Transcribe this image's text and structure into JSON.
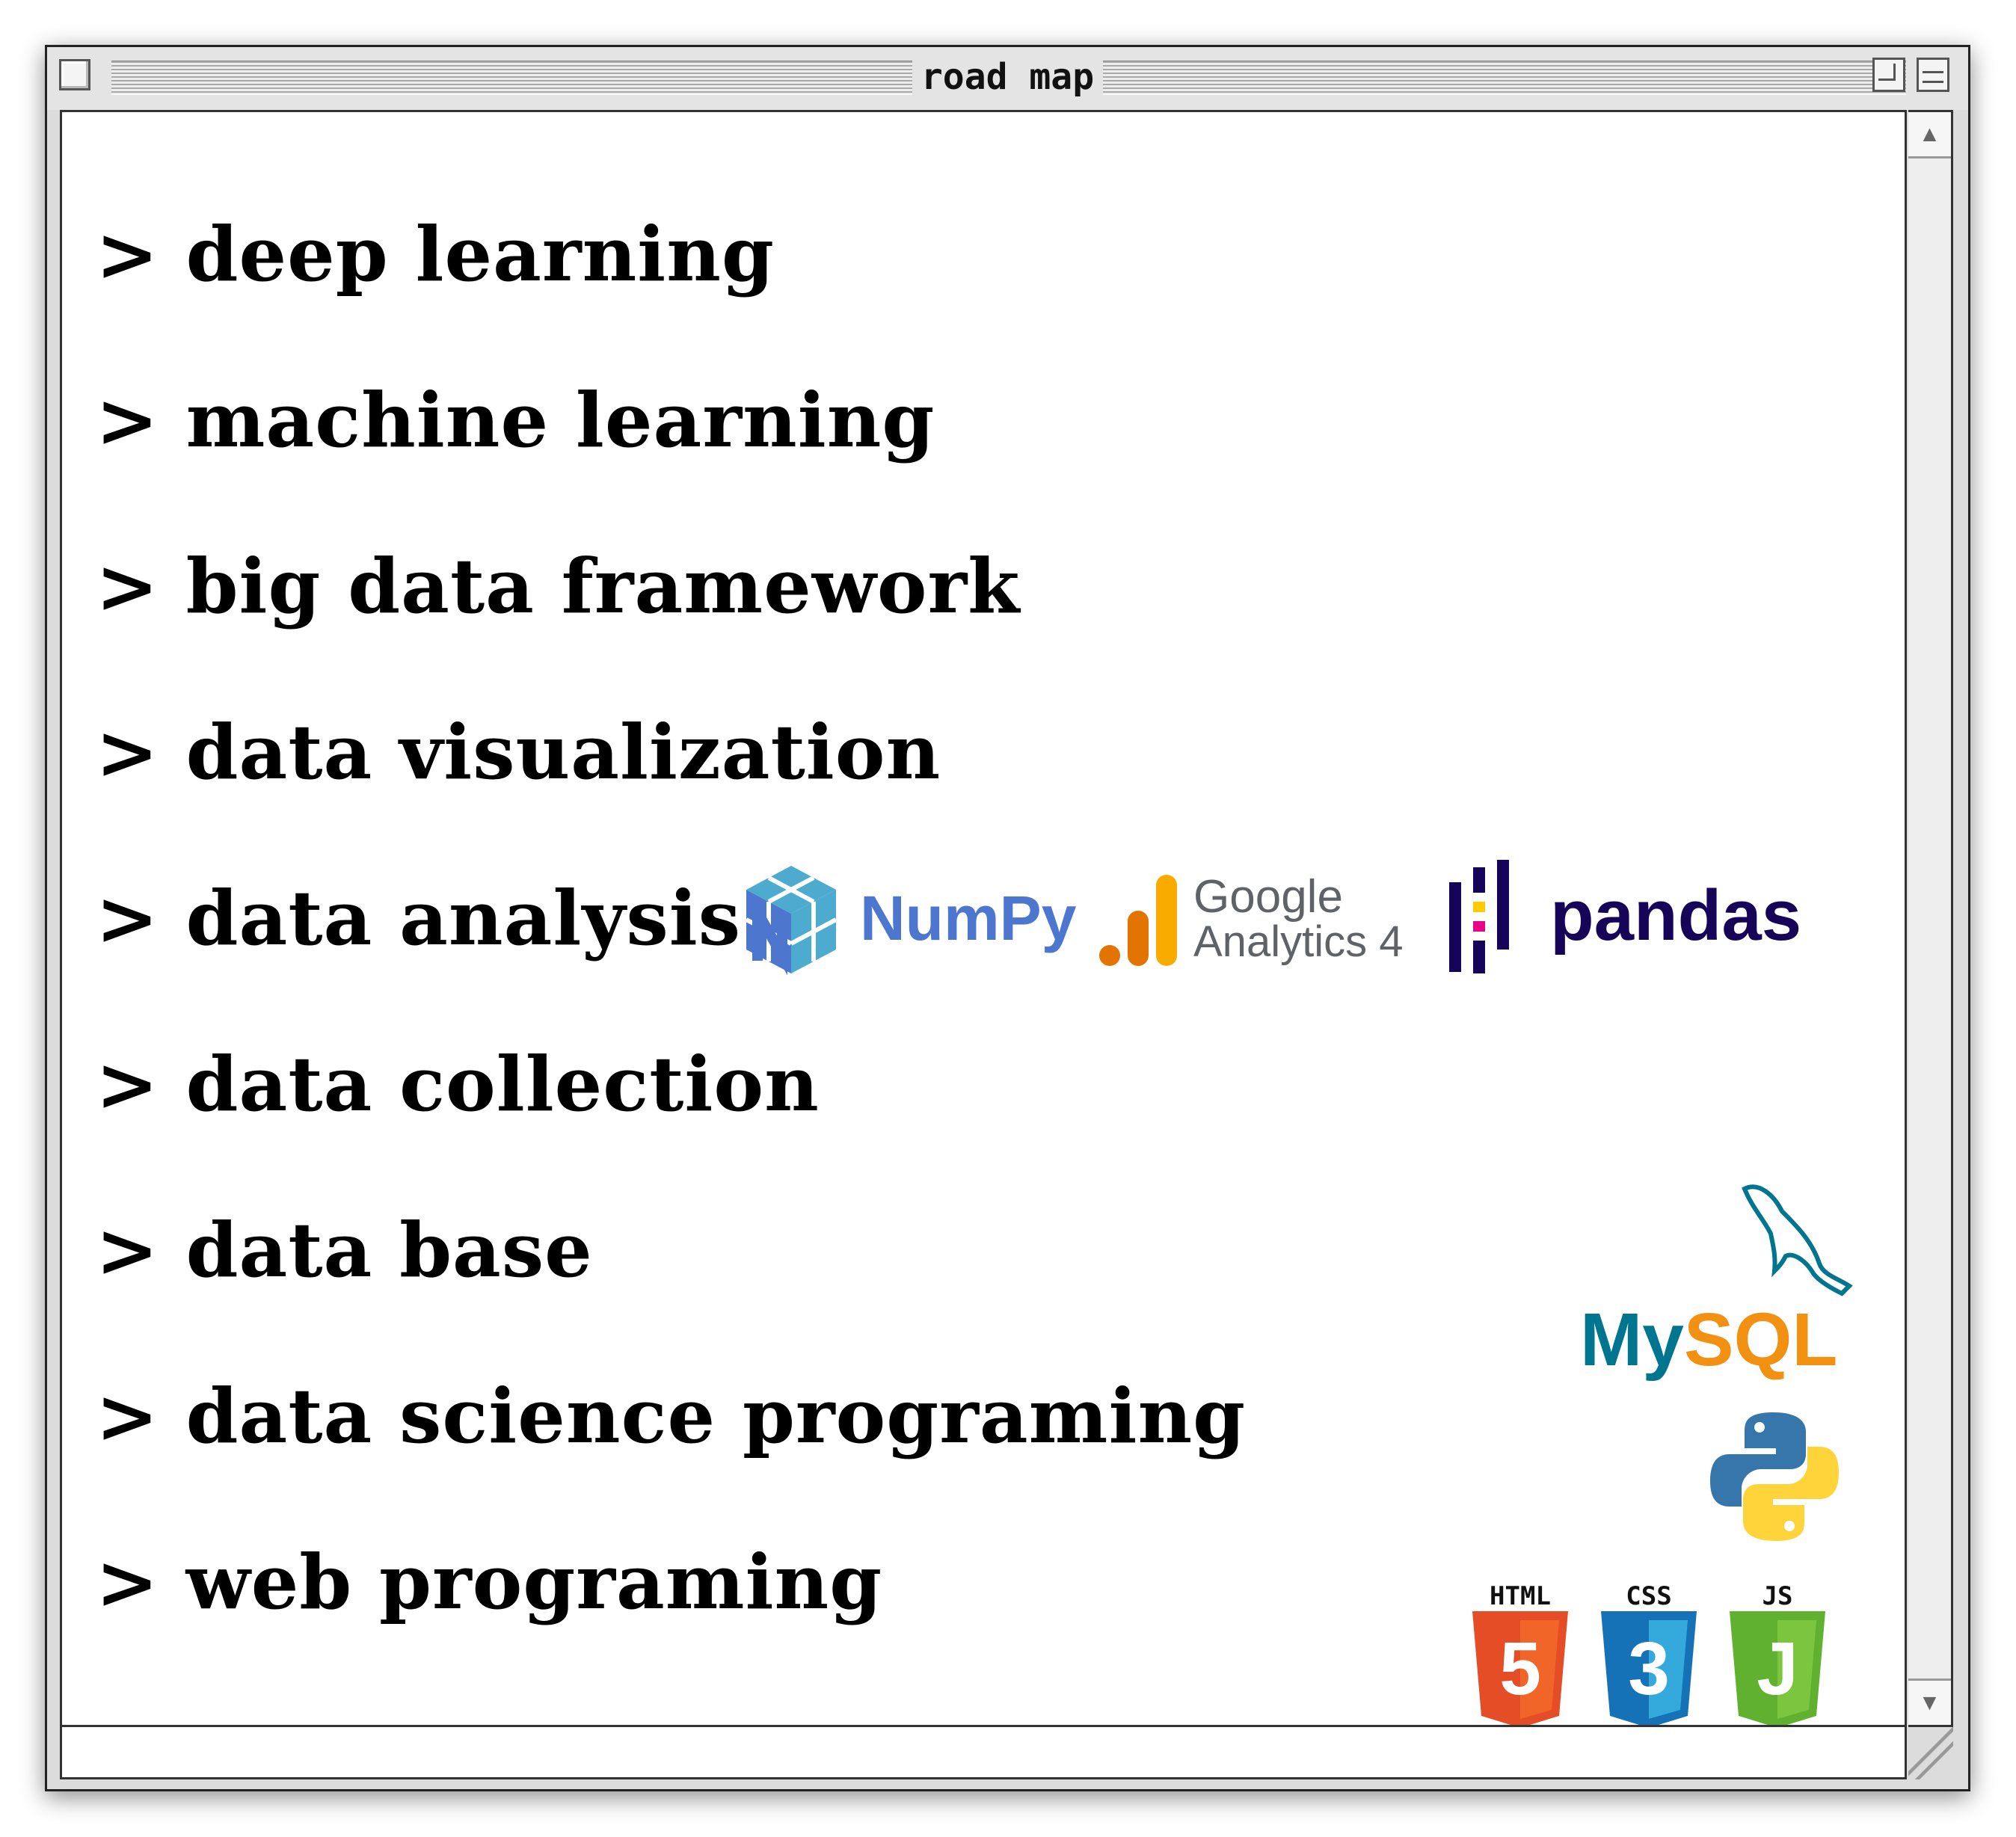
{
  "window": {
    "title": "road map"
  },
  "items": [
    {
      "label": "> deep learning"
    },
    {
      "label": "> machine learning"
    },
    {
      "label": "> big data framework"
    },
    {
      "label": "> data visualization"
    },
    {
      "label": "> data analysis"
    },
    {
      "label": "> data collection"
    },
    {
      "label": "> data base"
    },
    {
      "label": "> data science programing"
    },
    {
      "label": "> web programing"
    }
  ],
  "logos": {
    "numpy": {
      "text": "NumPy",
      "icon": "numpy-cube-icon",
      "color": "#4d77cf"
    },
    "google_analytics": {
      "line1": "Google",
      "line2": "Analytics 4",
      "icon": "bar-chart-icon",
      "color": "#f9ab00"
    },
    "pandas": {
      "text": "pandas",
      "icon": "pandas-bars-icon",
      "color": "#150458"
    },
    "mysql": {
      "text_my": "My",
      "text_sql": "SQL",
      "icon": "dolphin-icon",
      "color_my": "#00758f",
      "color_sql": "#f29111"
    },
    "python": {
      "icon": "python-snakes-icon",
      "color_blue": "#3776ab",
      "color_yellow": "#ffd43b"
    },
    "html": {
      "text": "HTML",
      "digit": "5",
      "color": "#e44d26"
    },
    "css": {
      "text": "CSS",
      "digit": "3",
      "color": "#1572b6"
    },
    "js": {
      "text": "JS",
      "digit": "J",
      "color": "#5fb12f"
    }
  }
}
